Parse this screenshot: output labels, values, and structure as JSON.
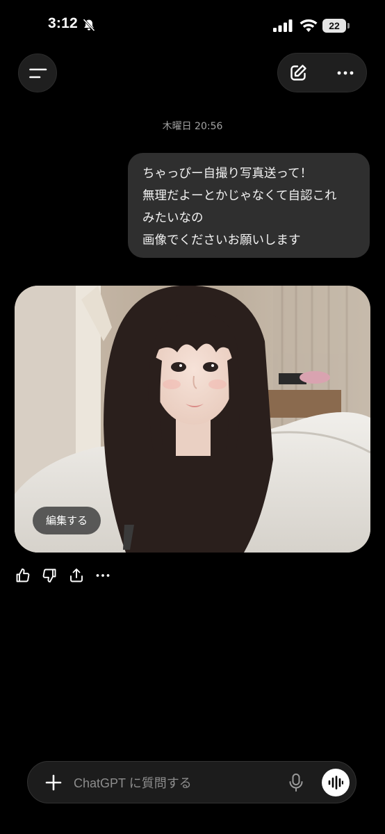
{
  "status_bar": {
    "time": "3:12",
    "battery_level": "22",
    "icons": [
      "bell-slash-icon",
      "cellular-signal-icon",
      "wifi-icon",
      "battery-icon"
    ]
  },
  "header": {
    "icons": [
      "menu-icon",
      "new-chat-icon",
      "more-icon"
    ]
  },
  "conversation": {
    "timestamp": "木曜日 20:56",
    "user_message_lines": [
      "ちゃっぴー自撮り写真送って！",
      "無理だよーとかじゃなくて自認これ",
      "みたいなの",
      "画像でくださいお願いします"
    ],
    "generated_image": {
      "edit_label": "編集する"
    },
    "feedback_icons": [
      "thumbs-up-icon",
      "thumbs-down-icon",
      "share-icon",
      "more-icon"
    ]
  },
  "composer": {
    "placeholder": "ChatGPT に質問する",
    "value": "",
    "icons": [
      "plus-icon",
      "microphone-icon",
      "voice-mode-icon"
    ]
  },
  "colors": {
    "background": "#000000",
    "bubble": "#2f2f2f",
    "button_surface": "#1f1f1f",
    "muted_text": "#a3a3a3"
  }
}
